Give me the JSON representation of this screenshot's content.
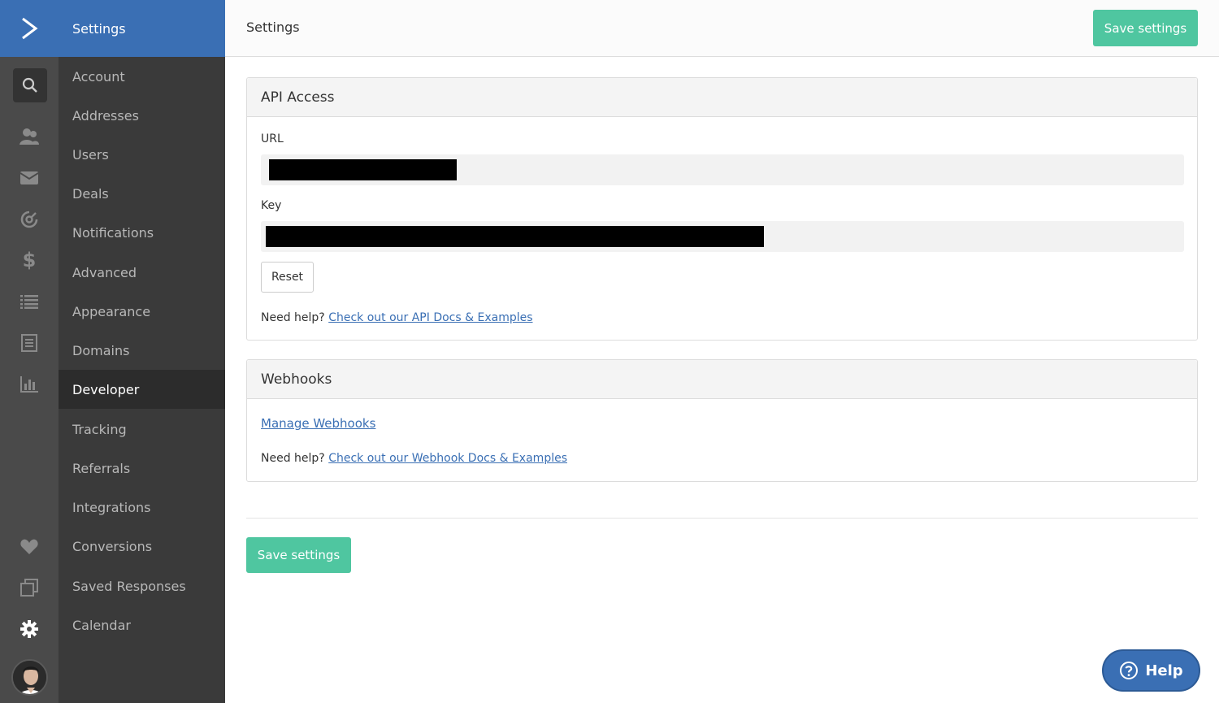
{
  "app": {
    "accent": "#3a6fb4",
    "success": "#4fc6a0"
  },
  "rail": {
    "icons": [
      "logo-icon",
      "search-icon",
      "contacts-icon",
      "mail-icon",
      "automation-icon",
      "dollar-icon",
      "list-icon",
      "forms-icon",
      "reports-icon",
      "heart-icon",
      "windows-icon",
      "gear-icon",
      "avatar"
    ]
  },
  "nav": {
    "header": "Settings",
    "items": [
      {
        "label": "Account"
      },
      {
        "label": "Addresses"
      },
      {
        "label": "Users"
      },
      {
        "label": "Deals"
      },
      {
        "label": "Notifications"
      },
      {
        "label": "Advanced"
      },
      {
        "label": "Appearance"
      },
      {
        "label": "Domains"
      },
      {
        "label": "Developer",
        "active": true
      },
      {
        "label": "Tracking"
      },
      {
        "label": "Referrals"
      },
      {
        "label": "Integrations"
      },
      {
        "label": "Conversions"
      },
      {
        "label": "Saved Responses"
      },
      {
        "label": "Calendar"
      }
    ]
  },
  "topbar": {
    "title": "Settings",
    "save_label": "Save settings"
  },
  "api": {
    "title": "API Access",
    "url_label": "URL",
    "key_label": "Key",
    "reset_label": "Reset",
    "help_prefix": "Need help?",
    "help_link": "Check out our API Docs & Examples"
  },
  "webhooks": {
    "title": "Webhooks",
    "manage_link": "Manage Webhooks",
    "help_prefix": "Need help?",
    "help_link": "Check out our Webhook Docs & Examples"
  },
  "footer": {
    "save_label": "Save settings"
  },
  "help_button": {
    "label": "Help"
  }
}
